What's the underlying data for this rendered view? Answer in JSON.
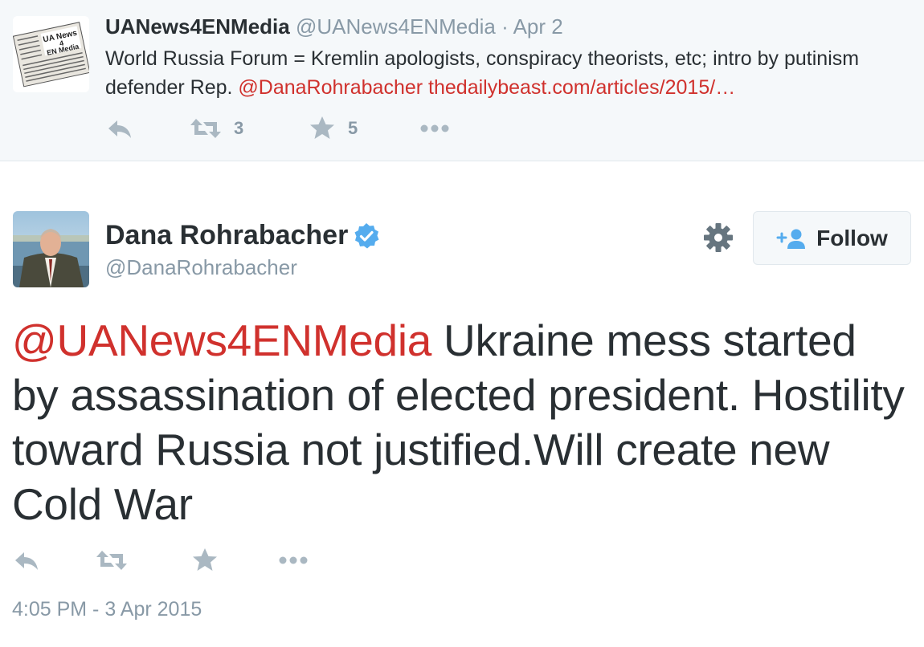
{
  "parent_tweet": {
    "avatar_logo_text": "UA News 4 EN Media",
    "name": "UANews4ENMedia",
    "handle": "@UANews4ENMedia",
    "separator": " · ",
    "date": "Apr 2",
    "text_part1": "World Russia Forum = Kremlin apologists, conspiracy theorists, etc; intro by putinism defender Rep. ",
    "mention": "@DanaRohrabacher",
    "link": "thedailybeast.com/articles/2015/…",
    "retweet_count": "3",
    "favorite_count": "5",
    "icons": [
      "reply-icon",
      "retweet-icon",
      "favorite-icon",
      "more-icon"
    ]
  },
  "main_tweet": {
    "name": "Dana Rohrabacher",
    "verified": true,
    "handle": "@DanaRohrabacher",
    "follow_label": "Follow",
    "mention": "@UANews4ENMedia",
    "text": " Ukraine mess started by assassination of elected president. Hostility toward Russia not justified.Will create new Cold War",
    "timestamp": "4:05 PM - 3 Apr 2015",
    "icons": [
      "reply-icon",
      "retweet-icon",
      "favorite-icon",
      "more-icon",
      "gear-icon",
      "follow-person-icon",
      "verified-badge-icon"
    ]
  },
  "colors": {
    "link": "#d0312d",
    "muted": "#8899a6",
    "verified": "#55acee",
    "text": "#292f33",
    "parent_bg": "#f5f8fa"
  }
}
